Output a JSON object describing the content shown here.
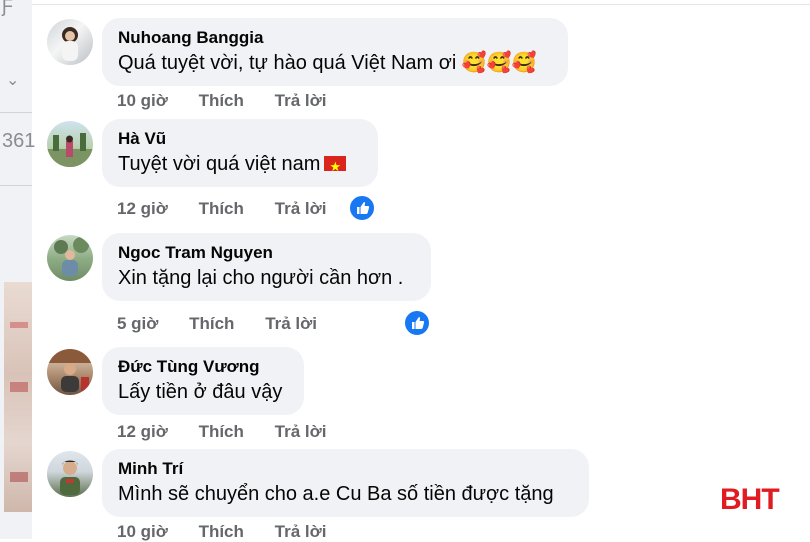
{
  "left_strip": {
    "frag1": "Ƒ",
    "frag2": "361"
  },
  "comments": [
    {
      "author": "Nuhoang Banggia",
      "text": "Quá tuyệt vời, tự hào quá Việt Nam ơi",
      "emoji": "🥰🥰🥰",
      "time": "10 giờ",
      "like": "Thích",
      "reply": "Trả lời"
    },
    {
      "author": "Hà Vũ",
      "text": "Tuyệt vời quá việt nam",
      "emoji": "",
      "time": "12 giờ",
      "like": "Thích",
      "reply": "Trả lời"
    },
    {
      "author": "Ngoc Tram Nguyen",
      "text": "Xin tặng lại cho người cần hơn .",
      "emoji": "",
      "time": "5 giờ",
      "like": "Thích",
      "reply": "Trả lời"
    },
    {
      "author": "Đức Tùng Vương",
      "text": "Lấy tiền ở đâu vậy",
      "emoji": "",
      "time": "12 giờ",
      "like": "Thích",
      "reply": "Trả lời"
    },
    {
      "author": "Minh Trí",
      "text": "Mình sẽ chuyển cho a.e Cu Ba số tiền được tặng",
      "emoji": "",
      "time": "10 giờ",
      "like": "Thích",
      "reply": "Trả lời"
    }
  ],
  "watermark": "BHT",
  "colors": {
    "reaction_blue": "#1877f2",
    "bubble_bg": "#f0f2f5",
    "logo_red": "#e01b22"
  }
}
